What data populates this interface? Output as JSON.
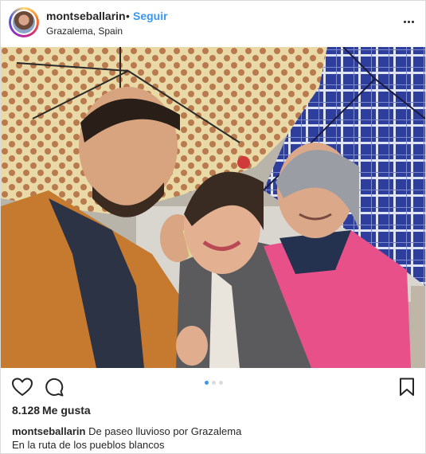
{
  "header": {
    "username": "montseballarin",
    "separator": "•",
    "follow_label": "Seguir",
    "location": "Grazalema, Spain"
  },
  "icons": {
    "more": "more-options-icon",
    "like": "heart-icon",
    "comment": "comment-icon",
    "save": "bookmark-icon"
  },
  "carousel": {
    "total": 3,
    "active_index": 0
  },
  "colors": {
    "follow": "#3897f0",
    "text": "#262626",
    "border": "#dbdbdb"
  },
  "likes": {
    "count": "8.128",
    "label": "Me gusta"
  },
  "caption": {
    "username": "montseballarin",
    "text": "De paseo lluvioso por Grazalema",
    "line2": "En la ruta de los pueblos blancos"
  }
}
